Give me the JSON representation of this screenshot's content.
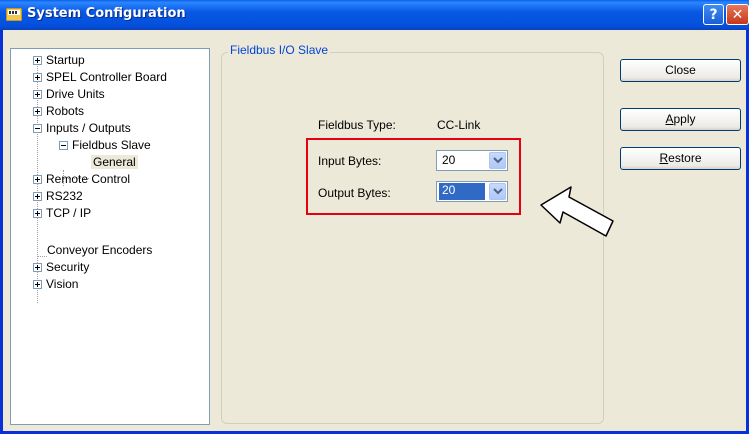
{
  "window": {
    "title": "System Configuration",
    "help_glyph": "?",
    "close_glyph": "✕"
  },
  "tree": {
    "items": [
      {
        "label": "Startup",
        "state": "collapsed"
      },
      {
        "label": "SPEL Controller Board",
        "state": "collapsed"
      },
      {
        "label": "Drive Units",
        "state": "collapsed"
      },
      {
        "label": "Robots",
        "state": "collapsed"
      },
      {
        "label": "Inputs / Outputs",
        "state": "expanded"
      },
      {
        "label": "Fieldbus Slave",
        "state": "expanded"
      },
      {
        "label": "General",
        "state": "selected"
      },
      {
        "label": "Remote Control",
        "state": "collapsed"
      },
      {
        "label": "RS232",
        "state": "collapsed"
      },
      {
        "label": "TCP / IP",
        "state": "collapsed"
      },
      {
        "label": "Conveyor Encoders",
        "state": "leaf"
      },
      {
        "label": "Security",
        "state": "collapsed"
      },
      {
        "label": "Vision",
        "state": "collapsed"
      }
    ]
  },
  "panel": {
    "group_title": "Fieldbus I/O Slave",
    "fieldbus_type_label": "Fieldbus Type:",
    "fieldbus_type_value": "CC-Link",
    "input_bytes_label": "Input Bytes:",
    "input_bytes_value": "20",
    "output_bytes_label": "Output Bytes:",
    "output_bytes_value": "20"
  },
  "buttons": {
    "close": "Close",
    "apply_first": "A",
    "apply_rest": "pply",
    "restore_first": "R",
    "restore_rest": "estore"
  },
  "annotation": {
    "highlight_color": "#e60012"
  }
}
